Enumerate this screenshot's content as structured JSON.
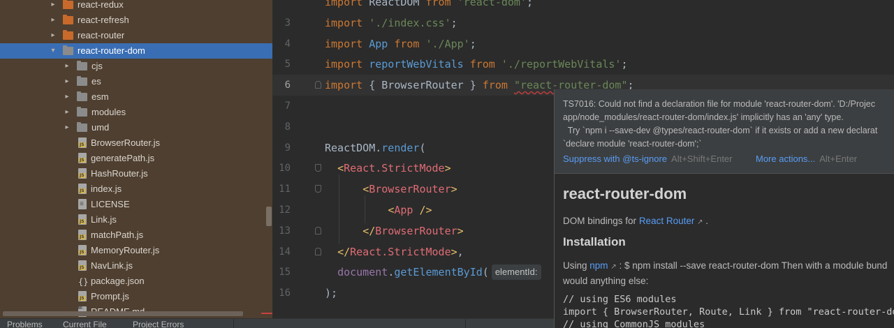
{
  "tree": {
    "items": [
      {
        "label": "react-redux",
        "kind": "folder",
        "color": "orange",
        "depth": 1,
        "expanded": false
      },
      {
        "label": "react-refresh",
        "kind": "folder",
        "color": "orange",
        "depth": 1,
        "expanded": false
      },
      {
        "label": "react-router",
        "kind": "folder",
        "color": "orange",
        "depth": 1,
        "expanded": false
      },
      {
        "label": "react-router-dom",
        "kind": "folder",
        "color": "grey",
        "depth": 1,
        "expanded": true,
        "selected": true
      },
      {
        "label": "cjs",
        "kind": "folder",
        "color": "grey",
        "depth": 2,
        "expanded": false
      },
      {
        "label": "es",
        "kind": "folder",
        "color": "grey",
        "depth": 2,
        "expanded": false
      },
      {
        "label": "esm",
        "kind": "folder",
        "color": "grey",
        "depth": 2,
        "expanded": false
      },
      {
        "label": "modules",
        "kind": "folder",
        "color": "grey",
        "depth": 2,
        "expanded": false
      },
      {
        "label": "umd",
        "kind": "folder",
        "color": "grey",
        "depth": 2,
        "expanded": false
      },
      {
        "label": "BrowserRouter.js",
        "kind": "js",
        "depth": 2
      },
      {
        "label": "generatePath.js",
        "kind": "js",
        "depth": 2
      },
      {
        "label": "HashRouter.js",
        "kind": "js",
        "depth": 2
      },
      {
        "label": "index.js",
        "kind": "js",
        "depth": 2
      },
      {
        "label": "LICENSE",
        "kind": "lic",
        "depth": 2
      },
      {
        "label": "Link.js",
        "kind": "js",
        "depth": 2
      },
      {
        "label": "matchPath.js",
        "kind": "js",
        "depth": 2
      },
      {
        "label": "MemoryRouter.js",
        "kind": "js",
        "depth": 2
      },
      {
        "label": "NavLink.js",
        "kind": "js",
        "depth": 2
      },
      {
        "label": "package.json",
        "kind": "json",
        "depth": 2
      },
      {
        "label": "Prompt.js",
        "kind": "js",
        "depth": 2
      },
      {
        "label": "README.md",
        "kind": "md",
        "depth": 2
      }
    ]
  },
  "editor": {
    "lines": [
      {
        "num": "",
        "html": "<span class=\"kw\">import</span> ReactDOM <span class=\"kw\">from</span> <span class=\"str\">'react-dom'</span>;"
      },
      {
        "num": "3",
        "html": "<span class=\"kw\">import</span> <span class=\"str\">'./index.css'</span>;"
      },
      {
        "num": "4",
        "html": "<span class=\"kw\">import</span> <span class=\"fn\">App</span> <span class=\"kw\">from</span> <span class=\"str\">'./App'</span>;"
      },
      {
        "num": "5",
        "html": "<span class=\"kw\">import</span> <span class=\"fn\">reportWebVitals</span> <span class=\"kw\">from</span> <span class=\"str\">'./reportWebVitals'</span>;"
      },
      {
        "num": "6",
        "current": true,
        "fold": "up",
        "html": "<span class=\"kw\">import</span> { BrowserRouter } <span class=\"kw\">from</span> <span class=\"str wavy\">\"react-router-dom\"</span>;"
      },
      {
        "num": "7",
        "html": ""
      },
      {
        "num": "8",
        "html": ""
      },
      {
        "num": "9",
        "html": "ReactDOM.<span class=\"fn\">render</span>("
      },
      {
        "num": "10",
        "fold": "down",
        "html": "  <span class=\"brk\">&lt;</span><span class=\"tag\">React.StrictMode</span><span class=\"brk\">&gt;</span>"
      },
      {
        "num": "11",
        "fold": "down",
        "html": "      <span class=\"brk\">&lt;</span><span class=\"tag\">BrowserRouter</span><span class=\"brk\">&gt;</span>"
      },
      {
        "num": "12",
        "html": "          <span class=\"brk\">&lt;</span><span class=\"tag\">App</span> <span class=\"brk\">/&gt;</span>"
      },
      {
        "num": "13",
        "fold": "up",
        "html": "      <span class=\"brk\">&lt;/</span><span class=\"tag\">BrowserRouter</span><span class=\"brk\">&gt;</span>"
      },
      {
        "num": "14",
        "fold": "up",
        "html": "  <span class=\"brk\">&lt;/</span><span class=\"tag\">React.StrictMode</span><span class=\"brk\">&gt;</span>,"
      },
      {
        "num": "15",
        "html": "  <span class=\"var\">document</span>.<span class=\"fn\">getElementById</span>(<span class=\"hint\">elementId:</span>"
      },
      {
        "num": "16",
        "html": ");"
      }
    ]
  },
  "popup": {
    "error_text": "TS7016: Could not find a declaration file for module 'react-router-dom'. 'D:/Projec\napp/node_modules/react-router-dom/index.js' implicitly has an 'any' type.\n  Try `npm i --save-dev @types/react-router-dom` if it exists or add a new declarat\n`declare module 'react-router-dom';`",
    "suppress_label": "Suppress with @ts-ignore",
    "suppress_shortcut": "Alt+Shift+Enter",
    "more_label": "More actions...",
    "more_shortcut": "Alt+Enter",
    "doc_title": "react-router-dom",
    "doc_desc_prefix": "DOM bindings for",
    "doc_desc_link": "React Router",
    "doc_desc_suffix": ".",
    "doc_h2": "Installation",
    "doc_use_prefix": "Using",
    "doc_use_link": "npm",
    "doc_use_suffix": ": $ npm install --save react-router-dom Then with a module bund",
    "doc_use2": "would anything else:",
    "code1": "// using ES6 modules",
    "code2": "import { BrowserRouter, Route, Link } from \"react-router-dom",
    "code3": "// using CommonJS modules"
  },
  "bottombar": {
    "tab1": "Problems",
    "tab2": "Current File",
    "tab3": "Project Errors"
  }
}
